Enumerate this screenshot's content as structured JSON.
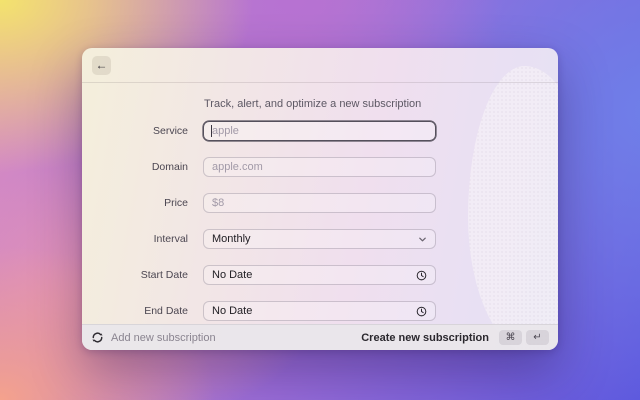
{
  "window": {
    "header": {
      "back_label": "←"
    },
    "form": {
      "description": "Track, alert, and optimize a new subscription",
      "fields": [
        {
          "label": "Service",
          "type": "text",
          "placeholder": "apple",
          "value": "",
          "focused": true
        },
        {
          "label": "Domain",
          "type": "text",
          "placeholder": "apple.com",
          "value": "",
          "focused": false
        },
        {
          "label": "Price",
          "type": "text",
          "placeholder": "$8",
          "value": "",
          "focused": false
        },
        {
          "label": "Interval",
          "type": "select",
          "value": "Monthly",
          "icon": "chevron-down"
        },
        {
          "label": "Start Date",
          "type": "date",
          "value": "No Date",
          "icon": "clock"
        },
        {
          "label": "End Date",
          "type": "date",
          "value": "No Date",
          "icon": "clock"
        }
      ]
    },
    "footer": {
      "command_icon": "sync-circular-arrows",
      "command_title": "Add new subscription",
      "primary_action_label": "Create new subscription",
      "shortcut_keys": [
        "⌘",
        "↵"
      ]
    }
  },
  "colors": {
    "focus_border": "#55505c",
    "placeholder_text": "#a29aa8",
    "value_text": "#1f1d22",
    "footer_bg": "#e9e6ea",
    "wallpaper_yellow": "#f3e36d",
    "wallpaper_pink": "#f09aae",
    "wallpaper_magenta": "#b772d2",
    "wallpaper_blue": "#6f80e9",
    "wallpaper_violet": "#5d59de"
  }
}
